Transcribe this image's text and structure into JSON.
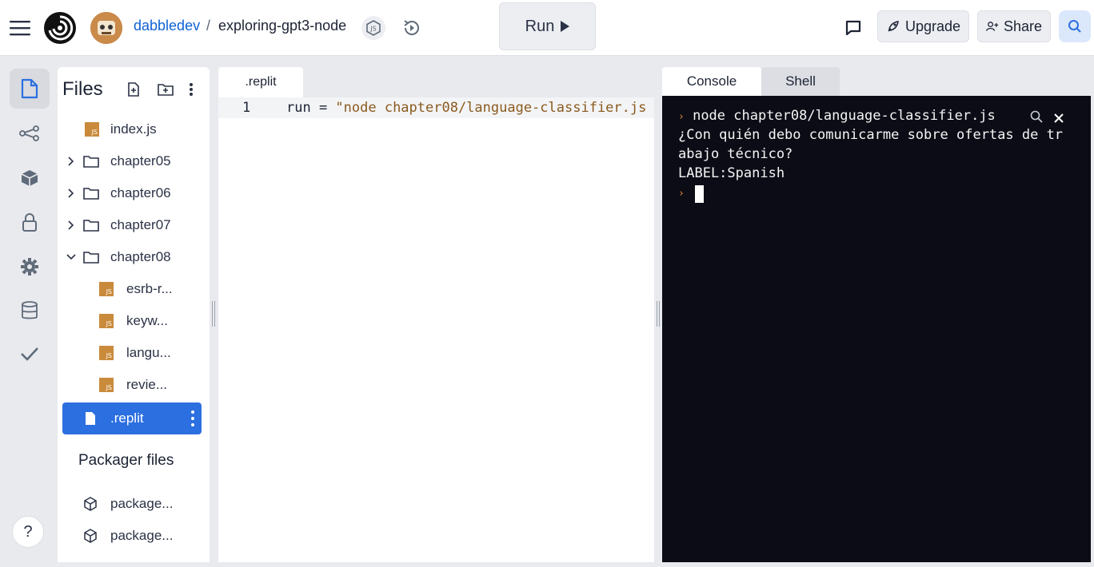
{
  "header": {
    "user": "dabbledev",
    "separator": "/",
    "repl_name": "exploring-gpt3-node",
    "run_label": "Run",
    "upgrade_label": "Upgrade",
    "share_label": "Share"
  },
  "sidebar": {
    "help_label": "?"
  },
  "files": {
    "title": "Files",
    "tree": [
      {
        "label": "index.js",
        "type": "js"
      },
      {
        "label": "chapter05",
        "type": "folder",
        "expanded": false
      },
      {
        "label": "chapter06",
        "type": "folder",
        "expanded": false
      },
      {
        "label": "chapter07",
        "type": "folder",
        "expanded": false
      },
      {
        "label": "chapter08",
        "type": "folder",
        "expanded": true
      },
      {
        "label": "esrb-r...",
        "type": "js"
      },
      {
        "label": "keyw...",
        "type": "js"
      },
      {
        "label": "langu...",
        "type": "js"
      },
      {
        "label": "revie...",
        "type": "js"
      },
      {
        "label": ".replit",
        "type": "file",
        "selected": true
      }
    ],
    "packager_title": "Packager files",
    "packager": [
      {
        "label": "package..."
      },
      {
        "label": "package..."
      }
    ]
  },
  "editor": {
    "tab": ".replit",
    "line_number": "1",
    "code_key": "run = ",
    "code_value": "\"node chapter08/language-classifier.js"
  },
  "console": {
    "tabs": [
      "Console",
      "Shell"
    ],
    "active_tab": "Console",
    "command": "node chapter08/language-classifier.js",
    "output_line1": "¿Con quién debo comunicarme sobre ofertas de tr",
    "output_line2": "abajo técnico?",
    "output_line3": "LABEL:Spanish",
    "prompt_symbol": "›"
  },
  "colors": {
    "accent": "#2c6fe0",
    "link": "#0f62d6",
    "terminal_bg": "#0b0c16",
    "js_icon": "#c98a3b"
  }
}
